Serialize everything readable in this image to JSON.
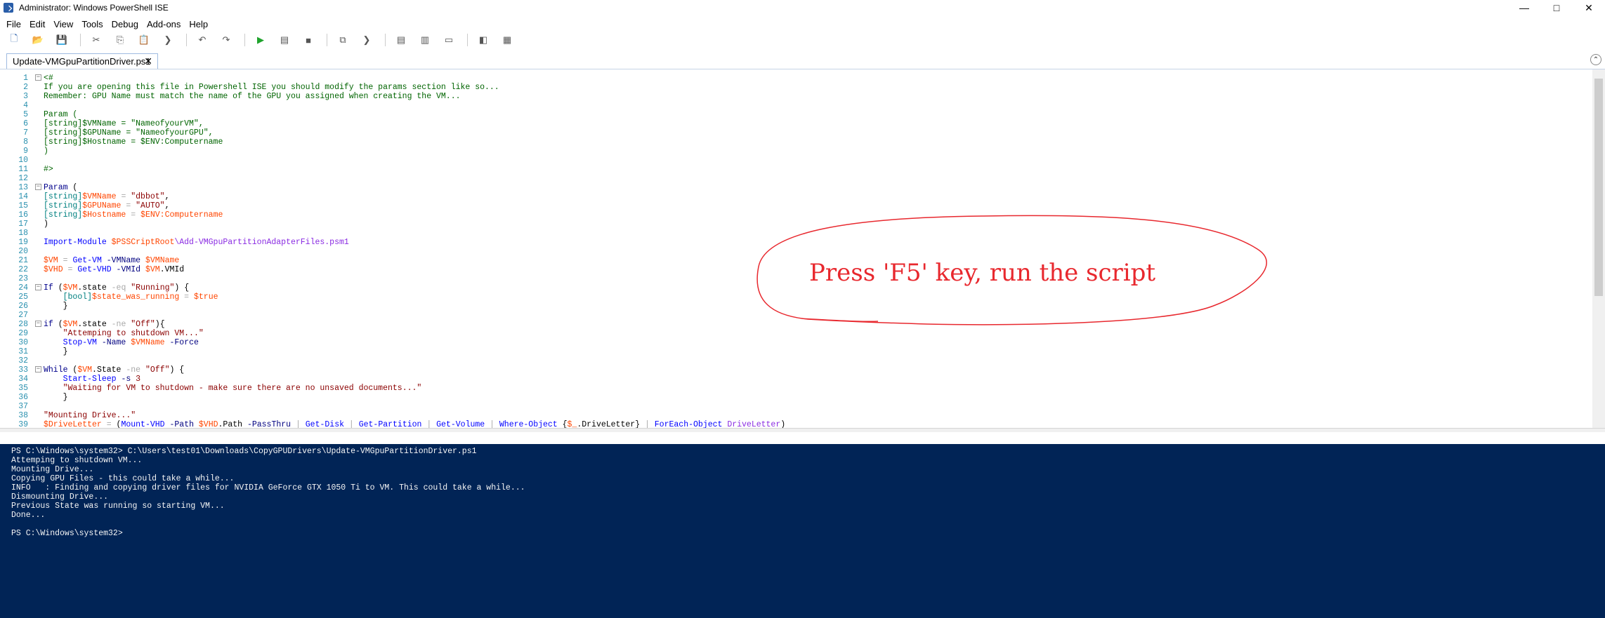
{
  "window": {
    "title": "Administrator: Windows PowerShell ISE"
  },
  "menu": [
    "File",
    "Edit",
    "View",
    "Tools",
    "Debug",
    "Add-ons",
    "Help"
  ],
  "toolbar": [
    "new-icon",
    "open-icon",
    "save-icon",
    "cut-icon",
    "copy-icon",
    "paste-icon",
    "powershell-prompt-icon",
    "undo-icon",
    "redo-icon",
    "run-icon",
    "run-selection-icon",
    "stop-icon",
    "remote-icon",
    "powershell-icon",
    "layout-top-icon",
    "layout-right-icon",
    "layout-max-icon",
    "script-pane-icon",
    "addon-icon"
  ],
  "tab": {
    "label": "Update-VMGpuPartitionDriver.ps1",
    "close": "✕"
  },
  "editor_lines": [
    [
      {
        "c": "cm",
        "t": "<#"
      }
    ],
    [
      {
        "c": "cm",
        "t": "If you are opening this file in Powershell ISE you should modify the params section like so..."
      }
    ],
    [
      {
        "c": "cm",
        "t": "Remember: GPU Name must match the name of the GPU you assigned when creating the VM..."
      }
    ],
    [
      {
        "c": "cm",
        "t": ""
      }
    ],
    [
      {
        "c": "cm",
        "t": "Param ("
      }
    ],
    [
      {
        "c": "cm",
        "t": "[string]$VMName = \"NameofyourVM\","
      }
    ],
    [
      {
        "c": "cm",
        "t": "[string]$GPUName = \"NameofyourGPU\","
      }
    ],
    [
      {
        "c": "cm",
        "t": "[string]$Hostname = $ENV:Computername"
      }
    ],
    [
      {
        "c": "cm",
        "t": ")"
      }
    ],
    [
      {
        "c": "cm",
        "t": ""
      }
    ],
    [
      {
        "c": "cm",
        "t": "#>"
      }
    ],
    [],
    [
      {
        "c": "kw",
        "t": "Param"
      },
      {
        "c": "plain",
        "t": " ("
      }
    ],
    [
      {
        "c": "typ",
        "t": "[string]"
      },
      {
        "c": "var",
        "t": "$VMName"
      },
      {
        "c": "plain",
        "t": " "
      },
      {
        "c": "op",
        "t": "="
      },
      {
        "c": "plain",
        "t": " "
      },
      {
        "c": "str",
        "t": "\"dbbot\""
      },
      {
        "c": "plain",
        "t": ","
      }
    ],
    [
      {
        "c": "typ",
        "t": "[string]"
      },
      {
        "c": "var",
        "t": "$GPUName"
      },
      {
        "c": "plain",
        "t": " "
      },
      {
        "c": "op",
        "t": "="
      },
      {
        "c": "plain",
        "t": " "
      },
      {
        "c": "str",
        "t": "\"AUTO\""
      },
      {
        "c": "plain",
        "t": ","
      }
    ],
    [
      {
        "c": "typ",
        "t": "[string]"
      },
      {
        "c": "var",
        "t": "$Hostname"
      },
      {
        "c": "plain",
        "t": " "
      },
      {
        "c": "op",
        "t": "="
      },
      {
        "c": "plain",
        "t": " "
      },
      {
        "c": "var",
        "t": "$ENV:Computername"
      }
    ],
    [
      {
        "c": "plain",
        "t": ")"
      }
    ],
    [],
    [
      {
        "c": "cmd",
        "t": "Import-Module"
      },
      {
        "c": "plain",
        "t": " "
      },
      {
        "c": "var",
        "t": "$PSSCriptRoot"
      },
      {
        "c": "arg",
        "t": "\\Add-VMGpuPartitionAdapterFiles.psm1"
      }
    ],
    [],
    [
      {
        "c": "var",
        "t": "$VM"
      },
      {
        "c": "plain",
        "t": " "
      },
      {
        "c": "op",
        "t": "="
      },
      {
        "c": "plain",
        "t": " "
      },
      {
        "c": "cmd",
        "t": "Get-VM"
      },
      {
        "c": "plain",
        "t": " "
      },
      {
        "c": "prm",
        "t": "-VMName"
      },
      {
        "c": "plain",
        "t": " "
      },
      {
        "c": "var",
        "t": "$VMName"
      }
    ],
    [
      {
        "c": "var",
        "t": "$VHD"
      },
      {
        "c": "plain",
        "t": " "
      },
      {
        "c": "op",
        "t": "="
      },
      {
        "c": "plain",
        "t": " "
      },
      {
        "c": "cmd",
        "t": "Get-VHD"
      },
      {
        "c": "plain",
        "t": " "
      },
      {
        "c": "prm",
        "t": "-VMId"
      },
      {
        "c": "plain",
        "t": " "
      },
      {
        "c": "var",
        "t": "$VM"
      },
      {
        "c": "plain",
        "t": ".VMId"
      }
    ],
    [],
    [
      {
        "c": "kw",
        "t": "If"
      },
      {
        "c": "plain",
        "t": " ("
      },
      {
        "c": "var",
        "t": "$VM"
      },
      {
        "c": "plain",
        "t": ".state "
      },
      {
        "c": "op",
        "t": "-eq"
      },
      {
        "c": "plain",
        "t": " "
      },
      {
        "c": "str",
        "t": "\"Running\""
      },
      {
        "c": "plain",
        "t": ") {"
      }
    ],
    [
      {
        "c": "plain",
        "t": "    "
      },
      {
        "c": "typ",
        "t": "[bool]"
      },
      {
        "c": "var",
        "t": "$state_was_running"
      },
      {
        "c": "plain",
        "t": " "
      },
      {
        "c": "op",
        "t": "="
      },
      {
        "c": "plain",
        "t": " "
      },
      {
        "c": "var",
        "t": "$true"
      }
    ],
    [
      {
        "c": "plain",
        "t": "    }"
      }
    ],
    [],
    [
      {
        "c": "kw",
        "t": "if"
      },
      {
        "c": "plain",
        "t": " ("
      },
      {
        "c": "var",
        "t": "$VM"
      },
      {
        "c": "plain",
        "t": ".state "
      },
      {
        "c": "op",
        "t": "-ne"
      },
      {
        "c": "plain",
        "t": " "
      },
      {
        "c": "str",
        "t": "\"Off\""
      },
      {
        "c": "plain",
        "t": "){"
      }
    ],
    [
      {
        "c": "plain",
        "t": "    "
      },
      {
        "c": "str",
        "t": "\"Attemping to shutdown VM...\""
      }
    ],
    [
      {
        "c": "plain",
        "t": "    "
      },
      {
        "c": "cmd",
        "t": "Stop-VM"
      },
      {
        "c": "plain",
        "t": " "
      },
      {
        "c": "prm",
        "t": "-Name"
      },
      {
        "c": "plain",
        "t": " "
      },
      {
        "c": "var",
        "t": "$VMName"
      },
      {
        "c": "plain",
        "t": " "
      },
      {
        "c": "prm",
        "t": "-Force"
      }
    ],
    [
      {
        "c": "plain",
        "t": "    }"
      }
    ],
    [],
    [
      {
        "c": "kw",
        "t": "While"
      },
      {
        "c": "plain",
        "t": " ("
      },
      {
        "c": "var",
        "t": "$VM"
      },
      {
        "c": "plain",
        "t": ".State "
      },
      {
        "c": "op",
        "t": "-ne"
      },
      {
        "c": "plain",
        "t": " "
      },
      {
        "c": "str",
        "t": "\"Off\""
      },
      {
        "c": "plain",
        "t": ") {"
      }
    ],
    [
      {
        "c": "plain",
        "t": "    "
      },
      {
        "c": "cmd",
        "t": "Start-Sleep"
      },
      {
        "c": "plain",
        "t": " "
      },
      {
        "c": "prm",
        "t": "-s"
      },
      {
        "c": "plain",
        "t": " "
      },
      {
        "c": "str",
        "t": "3"
      }
    ],
    [
      {
        "c": "plain",
        "t": "    "
      },
      {
        "c": "str",
        "t": "\"Waiting for VM to shutdown - make sure there are no unsaved documents...\""
      }
    ],
    [
      {
        "c": "plain",
        "t": "    }"
      }
    ],
    [],
    [
      {
        "c": "str",
        "t": "\"Mounting Drive...\""
      }
    ],
    [
      {
        "c": "var",
        "t": "$DriveLetter"
      },
      {
        "c": "plain",
        "t": " "
      },
      {
        "c": "op",
        "t": "="
      },
      {
        "c": "plain",
        "t": " ("
      },
      {
        "c": "cmd",
        "t": "Mount-VHD"
      },
      {
        "c": "plain",
        "t": " "
      },
      {
        "c": "prm",
        "t": "-Path"
      },
      {
        "c": "plain",
        "t": " "
      },
      {
        "c": "var",
        "t": "$VHD"
      },
      {
        "c": "plain",
        "t": ".Path "
      },
      {
        "c": "prm",
        "t": "-PassThru"
      },
      {
        "c": "plain",
        "t": " "
      },
      {
        "c": "op",
        "t": "|"
      },
      {
        "c": "plain",
        "t": " "
      },
      {
        "c": "cmd",
        "t": "Get-Disk"
      },
      {
        "c": "plain",
        "t": " "
      },
      {
        "c": "op",
        "t": "|"
      },
      {
        "c": "plain",
        "t": " "
      },
      {
        "c": "cmd",
        "t": "Get-Partition"
      },
      {
        "c": "plain",
        "t": " "
      },
      {
        "c": "op",
        "t": "|"
      },
      {
        "c": "plain",
        "t": " "
      },
      {
        "c": "cmd",
        "t": "Get-Volume"
      },
      {
        "c": "plain",
        "t": " "
      },
      {
        "c": "op",
        "t": "|"
      },
      {
        "c": "plain",
        "t": " "
      },
      {
        "c": "cmd",
        "t": "Where-Object"
      },
      {
        "c": "plain",
        "t": " {"
      },
      {
        "c": "var",
        "t": "$_"
      },
      {
        "c": "plain",
        "t": ".DriveLetter} "
      },
      {
        "c": "op",
        "t": "|"
      },
      {
        "c": "plain",
        "t": " "
      },
      {
        "c": "cmd",
        "t": "ForEach-Object"
      },
      {
        "c": "plain",
        "t": " "
      },
      {
        "c": "arg",
        "t": "DriveLetter"
      },
      {
        "c": "plain",
        "t": ")"
      }
    ]
  ],
  "fold_lines": [
    1,
    13,
    24,
    28,
    33
  ],
  "console_lines": [
    "PS C:\\Windows\\system32> C:\\Users\\test01\\Downloads\\CopyGPUDrivers\\Update-VMGpuPartitionDriver.ps1",
    "Attemping to shutdown VM...",
    "Mounting Drive...",
    "Copying GPU Files - this could take a while...",
    "INFO   : Finding and copying driver files for NVIDIA GeForce GTX 1050 Ti to VM. This could take a while...",
    "Dismounting Drive...",
    "Previous State was running so starting VM...",
    "Done...",
    "",
    "PS C:\\Windows\\system32>"
  ],
  "annotation": {
    "text": "Press 'F5' key, run the script",
    "color": "#e8282e"
  }
}
